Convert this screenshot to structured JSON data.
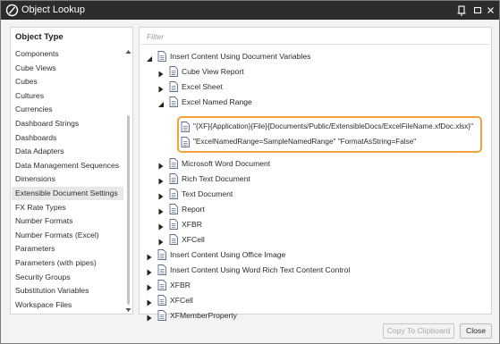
{
  "window": {
    "title": "Object Lookup",
    "accent_color": "#f2a33a"
  },
  "left_panel": {
    "header": "Object Type",
    "items": [
      "Components",
      "Cube Views",
      "Cubes",
      "Cultures",
      "Currencies",
      "Dashboard Strings",
      "Dashboards",
      "Data Adapters",
      "Data Management Sequences",
      "Dimensions",
      "Extensible Document Settings",
      "FX Rate Types",
      "Number Formats",
      "Number Formats (Excel)",
      "Parameters",
      "Parameters (with pipes)",
      "Security Groups",
      "Substitution Variables",
      "Workspace Files"
    ],
    "selected_item": "Extensible Document Settings"
  },
  "right_panel": {
    "filter_placeholder": "Filter",
    "tree": {
      "root": "Insert Content Using Document Variables",
      "cube_view_report": "Cube View Report",
      "excel_sheet": "Excel Sheet",
      "excel_named_range": "Excel Named Range",
      "leaf_1": "\"{XF}{Application}{File}{Documents/Public/ExtensibleDocs/ExcelFileName.xfDoc.xlsx}\"",
      "leaf_2": "\"ExcelNamedRange=SampleNamedRange\" \"FormatAsString=False\"",
      "word_document": "Microsoft Word Document",
      "rich_text_document": "Rich Text Document",
      "text_document": "Text Document",
      "report": "Report",
      "xfbr_child": "XFBR",
      "xfcell_child": "XFCell",
      "office_image": "Insert Content Using Office Image",
      "word_rich_text": "Insert Content Using Word Rich Text Content Control",
      "xfbr_top": "XFBR",
      "xfcell_top": "XFCell",
      "xfmemberproperty": "XFMemberProperty"
    }
  },
  "footer": {
    "copy_label": "Copy To Clipboard",
    "close_label": "Close"
  }
}
